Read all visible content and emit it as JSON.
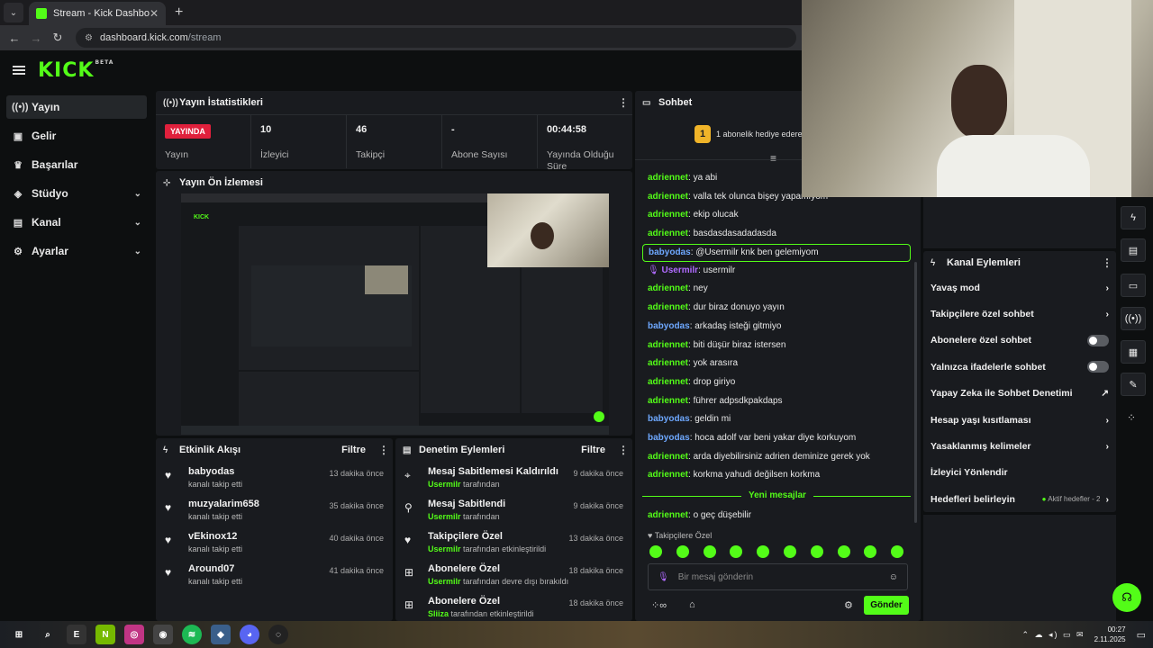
{
  "browser": {
    "tab_title": "Stream - Kick Dashboard",
    "url_host": "dashboard.kick.com",
    "url_path": "/stream"
  },
  "brand": {
    "logo": "KICK",
    "badge": "BETA"
  },
  "sidebar": {
    "items": [
      {
        "label": "Yayın",
        "icon": "broadcast-icon",
        "active": true
      },
      {
        "label": "Gelir",
        "icon": "wallet-icon"
      },
      {
        "label": "Başarılar",
        "icon": "trophy-icon"
      },
      {
        "label": "Stüdyo",
        "icon": "studio-icon",
        "expandable": true
      },
      {
        "label": "Kanal",
        "icon": "channel-icon",
        "expandable": true
      },
      {
        "label": "Ayarlar",
        "icon": "gear-icon",
        "expandable": true
      }
    ]
  },
  "stats_panel": {
    "title": "Yayın İstatistikleri",
    "items": [
      {
        "value": "YAYINDA",
        "label": "Yayın"
      },
      {
        "value": "10",
        "label": "İzleyici"
      },
      {
        "value": "46",
        "label": "Takipçi"
      },
      {
        "value": "-",
        "label": "Abone Sayısı"
      },
      {
        "value": "00:44:58",
        "label": "Yayında Olduğu Süre"
      }
    ]
  },
  "preview_panel": {
    "title": "Yayın Ön İzlemesi"
  },
  "activity_panel": {
    "title": "Etkinlik Akışı",
    "filter": "Filtre",
    "items": [
      {
        "title": "babyodas",
        "sub": "kanalı takip etti",
        "time": "13 dakika önce"
      },
      {
        "title": "muzyalarim658",
        "sub": "kanalı takip etti",
        "time": "35 dakika önce"
      },
      {
        "title": "vEkinox12",
        "sub": "kanalı takip etti",
        "time": "40 dakika önce"
      },
      {
        "title": "Around07",
        "sub": "kanalı takip etti",
        "time": "41 dakika önce"
      }
    ]
  },
  "moderation_panel": {
    "title": "Denetim Eylemleri",
    "filter": "Filtre",
    "items": [
      {
        "title": "Mesaj Sabitlemesi Kaldırıldı",
        "user": "Usermilr",
        "sub": "tarafından",
        "time": "9 dakika önce"
      },
      {
        "title": "Mesaj Sabitlendi",
        "user": "Usermilr",
        "sub": "tarafından",
        "time": "9 dakika önce"
      },
      {
        "title": "Takipçilere Özel",
        "user": "Usermilr",
        "sub": "tarafından etkinleştirildi",
        "time": "13 dakika önce"
      },
      {
        "title": "Abonelere Özel",
        "user": "Usermilr",
        "sub": "tarafından devre dışı bırakıldı",
        "time": "18 dakika önce"
      },
      {
        "title": "Abonelere Özel",
        "user": "Sliiza",
        "sub": "tarafından etkinleştirildi",
        "time": "18 dakika önce"
      }
    ]
  },
  "chat": {
    "title": "Sohbet",
    "gift_count": "1",
    "gift_text": "1 abonelik hediye ederek",
    "messages": [
      {
        "user": "adriennet",
        "text": "ya abi",
        "color": "green"
      },
      {
        "user": "adriennet",
        "text": "valla tek olunca bişey yapamıyom",
        "color": "green"
      },
      {
        "user": "adriennet",
        "text": "ekip olucak",
        "color": "green"
      },
      {
        "user": "adriennet",
        "text": "basdasdasadadasda",
        "color": "green"
      },
      {
        "user": "babyodas",
        "text": "@Usermilr knk ben gelemiyom",
        "color": "blue",
        "highlight": true
      },
      {
        "user": "Usermilr",
        "text": "usermilr",
        "color": "purple",
        "mic": true
      },
      {
        "user": "adriennet",
        "text": "ney",
        "color": "green"
      },
      {
        "user": "adriennet",
        "text": "dur biraz donuyo yayın",
        "color": "green"
      },
      {
        "user": "babyodas",
        "text": "arkadaş isteği gitmiyo",
        "color": "blue"
      },
      {
        "user": "adriennet",
        "text": "biti düşür biraz istersen",
        "color": "green"
      },
      {
        "user": "adriennet",
        "text": "yok arasıra",
        "color": "green"
      },
      {
        "user": "adriennet",
        "text": "drop giriyo",
        "color": "green"
      },
      {
        "user": "adriennet",
        "text": "führer adpsdkpakdaps",
        "color": "green"
      },
      {
        "user": "babyodas",
        "text": "geldin mi",
        "color": "blue"
      },
      {
        "user": "babyodas",
        "text": "hoca adolf var beni yakar diye korkuyom",
        "color": "blue"
      },
      {
        "user": "adriennet",
        "text": "arda diyebilirsiniz adrien deminize gerek yok",
        "color": "green"
      },
      {
        "user": "adriennet",
        "text": "korkma yahudi değilsen korkma",
        "color": "green"
      }
    ],
    "new_messages_label": "Yeni mesajlar",
    "after_messages": [
      {
        "user": "adriennet",
        "text": "o geç düşebilir",
        "color": "green"
      }
    ],
    "followers_only_label": "Takipçilere Özel",
    "input_placeholder": "Bir mesaj gönderin",
    "send_label": "Gönder"
  },
  "channel_actions": {
    "title": "Kanal Eylemleri",
    "items": [
      {
        "label": "Yavaş mod",
        "control": "chevron"
      },
      {
        "label": "Takipçilere özel sohbet",
        "control": "chevron"
      },
      {
        "label": "Abonelere özel sohbet",
        "control": "toggle"
      },
      {
        "label": "Yalnızca ifadelerle sohbet",
        "control": "toggle"
      },
      {
        "label": "Yapay Zeka ile Sohbet Denetimi",
        "control": "external"
      },
      {
        "label": "Hesap yaşı kısıtlaması",
        "control": "chevron"
      },
      {
        "label": "Yasaklanmış kelimeler",
        "control": "chevron"
      },
      {
        "label": "İzleyici Yönlendir",
        "control": "none"
      },
      {
        "label": "Hedefleri belirleyin",
        "control": "chevron",
        "extra": "Aktif hedefler - 2"
      }
    ]
  },
  "taskbar": {
    "time": "00:27",
    "date": "2.11.2025",
    "apps": [
      "windows-icon",
      "search-icon",
      "epic-games-icon",
      "nvidia-icon",
      "instagram-icon",
      "chrome-icon",
      "spotify-icon",
      "app-icon",
      "discord-icon",
      "obs-icon"
    ]
  },
  "colors": {
    "accent": "#53fc18",
    "live": "#e0203c",
    "panel": "#191b1f",
    "bg": "#0d0f10"
  }
}
